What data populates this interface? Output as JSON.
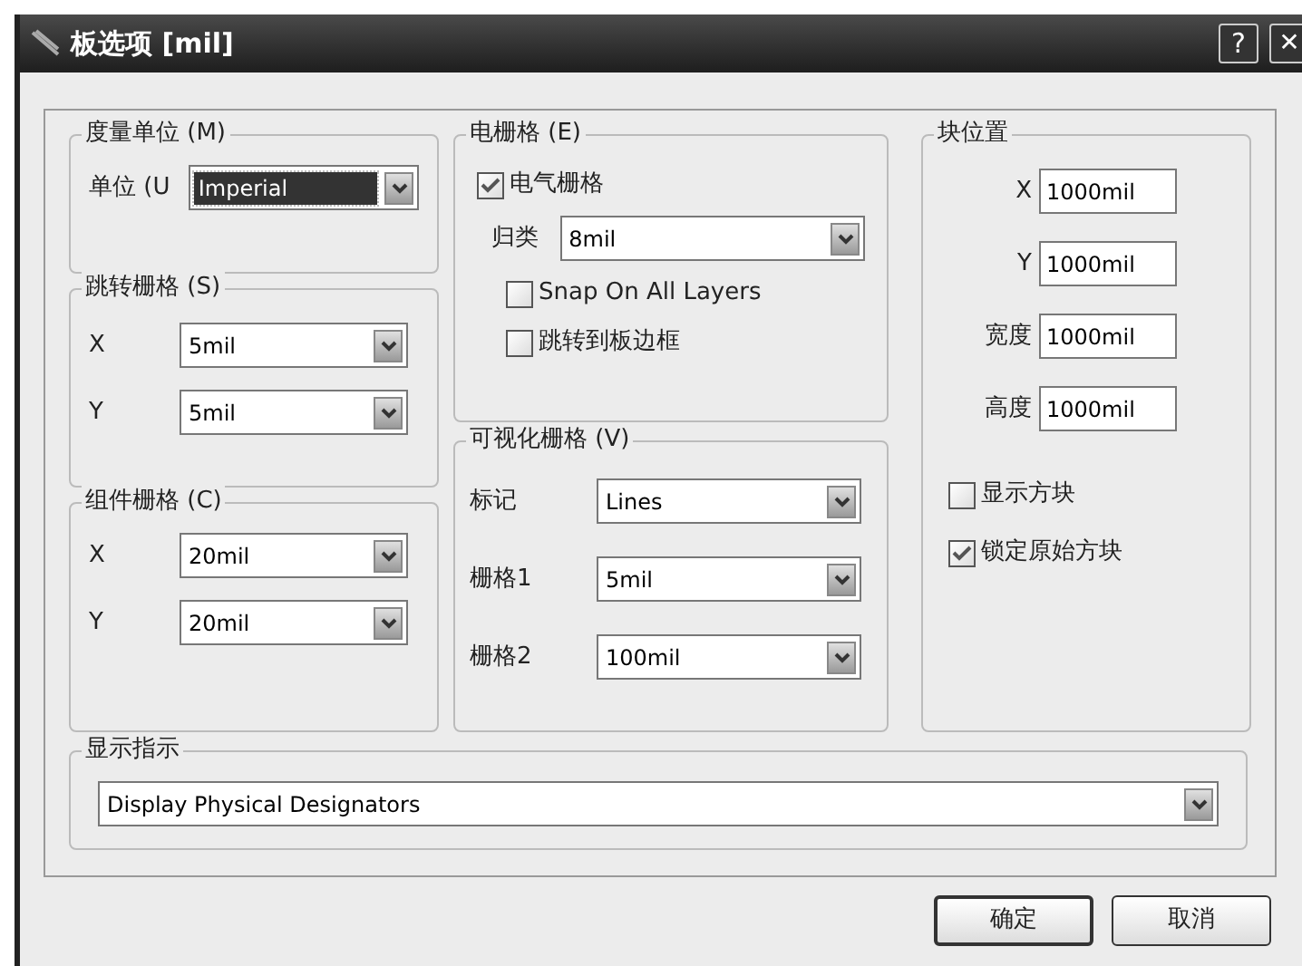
{
  "window": {
    "title": "板选项 [mil]",
    "help": "?",
    "close": "✕"
  },
  "measurement_unit": {
    "title": "度量单位 (M)",
    "label": "单位 (U",
    "value": "Imperial",
    "focused": true
  },
  "snap_grid": {
    "title": "跳转栅格 (S)",
    "rows": [
      {
        "label": "X",
        "value": "5mil"
      },
      {
        "label": "Y",
        "value": "5mil"
      }
    ]
  },
  "component_grid": {
    "title": "组件栅格 (C)",
    "rows": [
      {
        "label": "X",
        "value": "20mil"
      },
      {
        "label": "Y",
        "value": "20mil"
      }
    ]
  },
  "electrical_grid": {
    "title": "电栅格 (E)",
    "enable": {
      "label": "电气栅格",
      "checked": true
    },
    "range_label": "归类",
    "range_value": "8mil",
    "options": [
      {
        "label": "Snap On All Layers",
        "checked": false
      },
      {
        "label": "跳转到板边框",
        "checked": false
      }
    ]
  },
  "visible_grid": {
    "title": "可视化栅格 (V)",
    "rows": [
      {
        "label": "标记",
        "value": "Lines"
      },
      {
        "label": "栅格1",
        "value": "5mil"
      },
      {
        "label": "栅格2",
        "value": "100mil"
      }
    ]
  },
  "sheet_position": {
    "title": "块位置",
    "fields": [
      {
        "label": "X",
        "value": "1000mil"
      },
      {
        "label": "Y",
        "value": "1000mil"
      },
      {
        "label": "宽度",
        "value": "1000mil"
      },
      {
        "label": "高度",
        "value": "1000mil"
      }
    ],
    "options": [
      {
        "label": "显示方块",
        "checked": false
      },
      {
        "label": "锁定原始方块",
        "checked": true
      }
    ]
  },
  "designator_display": {
    "title": "显示指示",
    "value": "Display Physical Designators"
  },
  "buttons": [
    "确定",
    "取消"
  ]
}
